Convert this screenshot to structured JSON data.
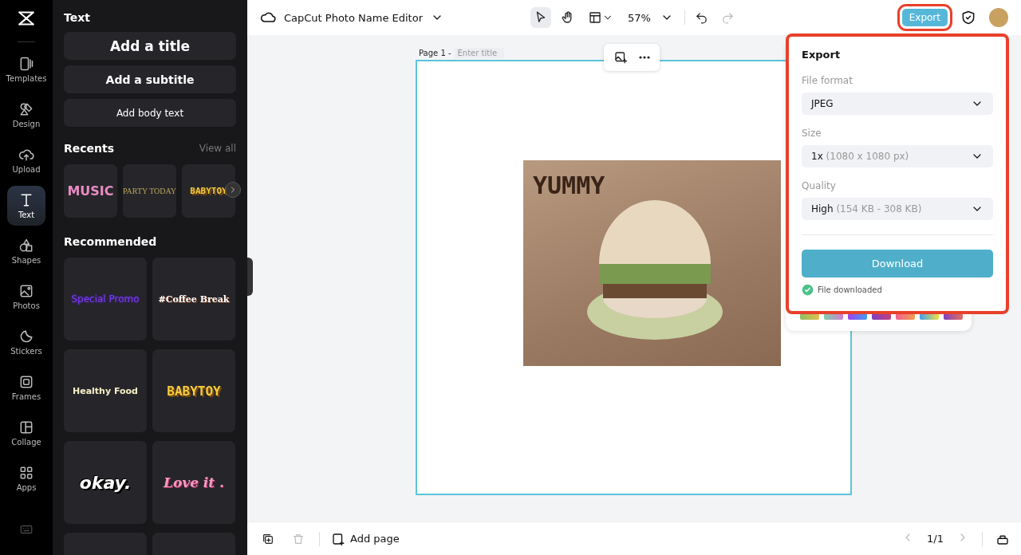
{
  "rail": {
    "items": [
      {
        "label": "Templates",
        "kind": "templates",
        "selected": false
      },
      {
        "label": "Design",
        "kind": "design",
        "selected": false
      },
      {
        "label": "Upload",
        "kind": "upload",
        "selected": false
      },
      {
        "label": "Text",
        "kind": "text",
        "selected": true
      },
      {
        "label": "Shapes",
        "kind": "shapes",
        "selected": false
      },
      {
        "label": "Photos",
        "kind": "photos",
        "selected": false
      },
      {
        "label": "Stickers",
        "kind": "stickers",
        "selected": false
      },
      {
        "label": "Frames",
        "kind": "frames",
        "selected": false
      },
      {
        "label": "Collage",
        "kind": "collage",
        "selected": false
      },
      {
        "label": "Apps",
        "kind": "apps",
        "selected": false
      }
    ]
  },
  "panel": {
    "title": "Text",
    "presets": [
      {
        "label": "Add a title",
        "kind": "title"
      },
      {
        "label": "Add a subtitle",
        "kind": "subtitle"
      },
      {
        "label": "Add body text",
        "kind": "body"
      }
    ],
    "recents": {
      "title": "Recents",
      "link": "View all",
      "items": [
        {
          "label": "MUSIC",
          "kind": "music"
        },
        {
          "label": "PARTY TODAY",
          "kind": "party"
        },
        {
          "label": "BABYTOY",
          "kind": "babytoy"
        }
      ]
    },
    "recommended": {
      "title": "Recommended",
      "items": [
        {
          "label": "Special Promo",
          "kind": "promo"
        },
        {
          "label": "#Coffee Break",
          "kind": "coffee"
        },
        {
          "label": "Healthy Food",
          "kind": "healthy"
        },
        {
          "label": "BABYTOY",
          "kind": "babytoy"
        },
        {
          "label": "okay.",
          "kind": "okay"
        },
        {
          "label": "Love it .",
          "kind": "love"
        }
      ]
    }
  },
  "topbar": {
    "title": "CapCut Photo Name Editor",
    "zoom": "57%",
    "export": "Export"
  },
  "canvas": {
    "page_label": "Page 1 -",
    "title_placeholder": "Enter title",
    "image_text": "YUMMY"
  },
  "export_panel": {
    "title": "Export",
    "fields": [
      {
        "label": "File format",
        "value": "JPEG"
      },
      {
        "label": "Size",
        "value": "1x",
        "detail": "(1080 x 1080 px)"
      },
      {
        "label": "Quality",
        "value": "High",
        "detail": "(154 KB - 308 KB)"
      }
    ],
    "button": "Download",
    "status": "File downloaded"
  },
  "bottombar": {
    "add_page": "Add page",
    "pages": "1/1"
  }
}
